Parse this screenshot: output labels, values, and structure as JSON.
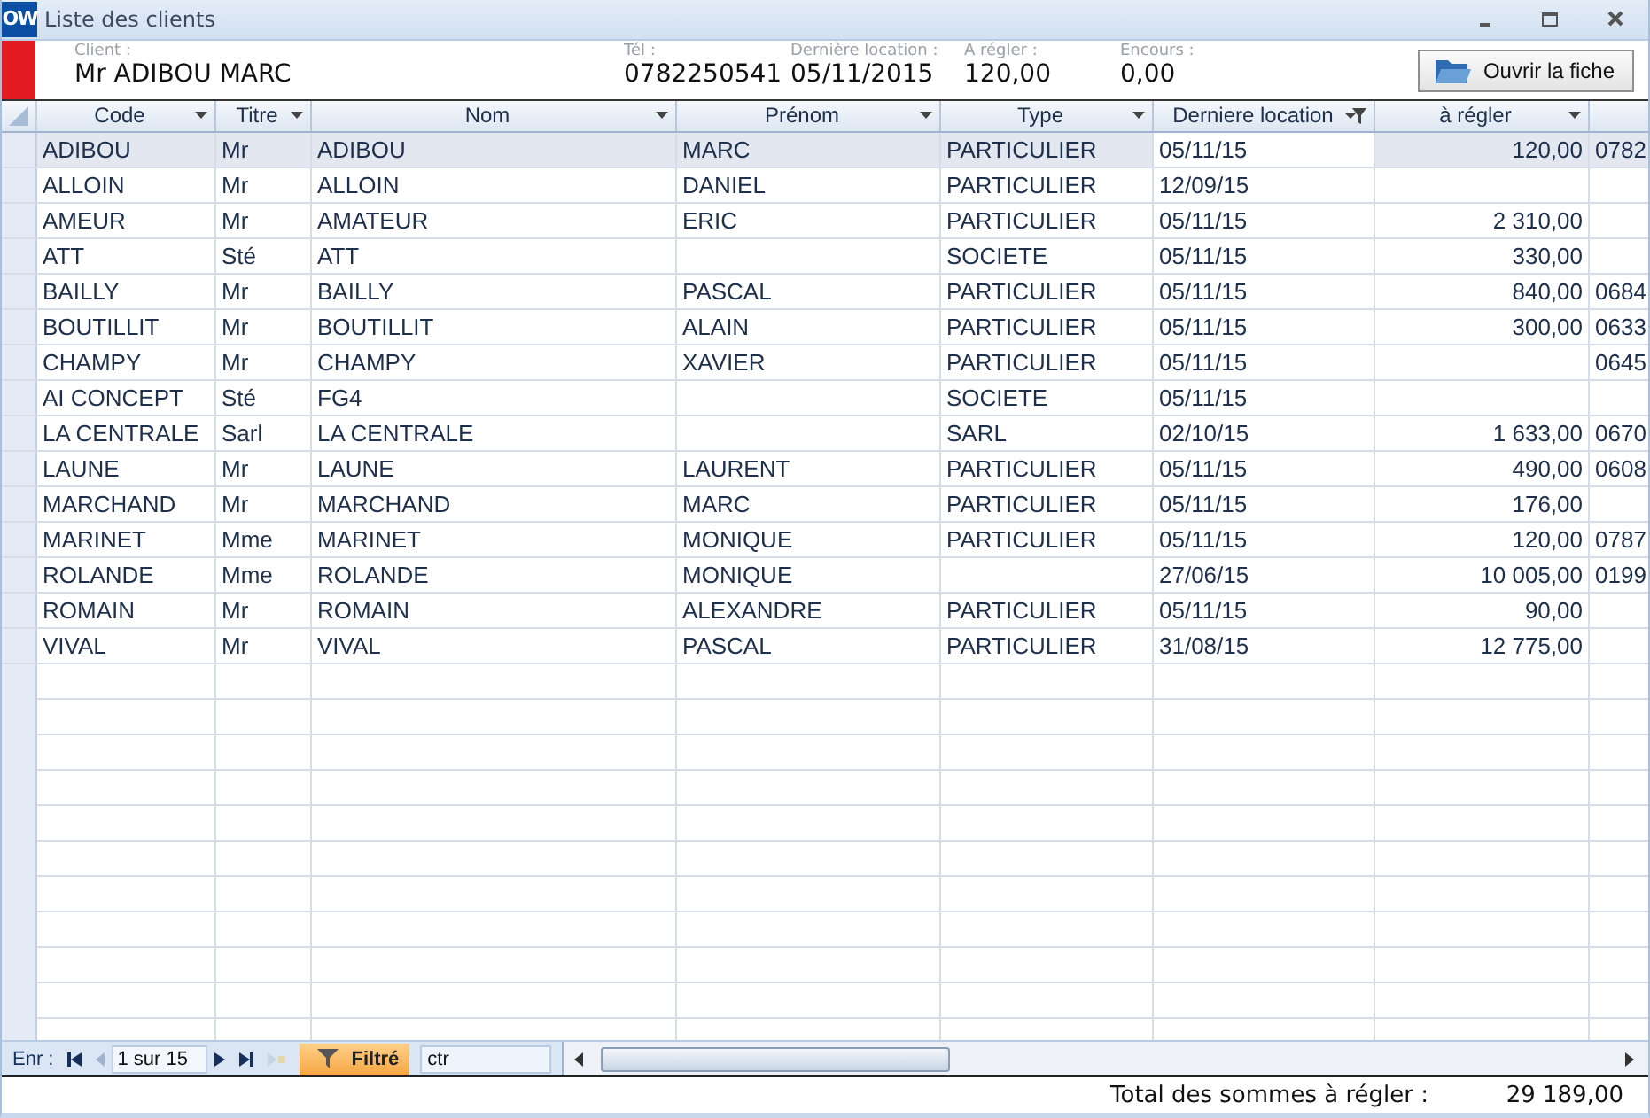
{
  "window": {
    "badge": "OW",
    "title": "Liste des clients"
  },
  "summary": {
    "fields": [
      {
        "label": "Client :",
        "value": "Mr ADIBOU MARC"
      },
      {
        "label": "Tél :",
        "value": "0782250541"
      },
      {
        "label": "Dernière location :",
        "value": "05/11/2015"
      },
      {
        "label": "A régler :",
        "value": "120,00"
      },
      {
        "label": "Encours :",
        "value": "0,00"
      }
    ],
    "open_button": "Ouvrir la fiche"
  },
  "table": {
    "columns": [
      {
        "label": "Code",
        "filtered": false
      },
      {
        "label": "Titre",
        "filtered": false
      },
      {
        "label": "Nom",
        "filtered": false
      },
      {
        "label": "Prénom",
        "filtered": false
      },
      {
        "label": "Type",
        "filtered": false
      },
      {
        "label": "Derniere location",
        "filtered": true
      },
      {
        "label": "à régler",
        "filtered": false
      },
      {}
    ],
    "rows": [
      {
        "selected": true,
        "cells": [
          "ADIBOU",
          "Mr",
          "ADIBOU",
          "MARC",
          "PARTICULIER",
          "05/11/15",
          "120,00",
          "0782"
        ]
      },
      {
        "selected": false,
        "cells": [
          "ALLOIN",
          "Mr",
          "ALLOIN",
          "DANIEL",
          "PARTICULIER",
          "12/09/15",
          null,
          null
        ]
      },
      {
        "selected": false,
        "cells": [
          "AMEUR",
          "Mr",
          "AMATEUR",
          "ERIC",
          "PARTICULIER",
          "05/11/15",
          "2 310,00",
          null
        ]
      },
      {
        "selected": false,
        "cells": [
          "ATT",
          "Sté",
          "ATT",
          null,
          "SOCIETE",
          "05/11/15",
          "330,00",
          null
        ]
      },
      {
        "selected": false,
        "cells": [
          "BAILLY",
          "Mr",
          "BAILLY",
          "PASCAL",
          "PARTICULIER",
          "05/11/15",
          "840,00",
          "0684"
        ]
      },
      {
        "selected": false,
        "cells": [
          "BOUTILLIT",
          "Mr",
          "BOUTILLIT",
          "ALAIN",
          "PARTICULIER",
          "05/11/15",
          "300,00",
          "0633"
        ]
      },
      {
        "selected": false,
        "cells": [
          "CHAMPY",
          "Mr",
          "CHAMPY",
          "XAVIER",
          "PARTICULIER",
          "05/11/15",
          null,
          "0645"
        ]
      },
      {
        "selected": false,
        "cells": [
          "AI CONCEPT",
          "Sté",
          "FG4",
          null,
          "SOCIETE",
          "05/11/15",
          null,
          null
        ]
      },
      {
        "selected": false,
        "cells": [
          "LA CENTRALE",
          "Sarl",
          "LA CENTRALE",
          null,
          "SARL",
          "02/10/15",
          "1 633,00",
          "0670"
        ]
      },
      {
        "selected": false,
        "cells": [
          "LAUNE",
          "Mr",
          "LAUNE",
          "LAURENT",
          "PARTICULIER",
          "05/11/15",
          "490,00",
          "0608"
        ]
      },
      {
        "selected": false,
        "cells": [
          "MARCHAND",
          "Mr",
          "MARCHAND",
          "MARC",
          "PARTICULIER",
          "05/11/15",
          "176,00",
          null
        ]
      },
      {
        "selected": false,
        "cells": [
          "MARINET",
          "Mme",
          "MARINET",
          "MONIQUE",
          "PARTICULIER",
          "05/11/15",
          "120,00",
          "0787"
        ]
      },
      {
        "selected": false,
        "cells": [
          "ROLANDE",
          "Mme",
          "ROLANDE",
          "MONIQUE",
          null,
          "27/06/15",
          "10 005,00",
          "0199"
        ]
      },
      {
        "selected": false,
        "cells": [
          "ROMAIN",
          "Mr",
          "ROMAIN",
          "ALEXANDRE",
          "PARTICULIER",
          "05/11/15",
          "90,00",
          null
        ]
      },
      {
        "selected": false,
        "cells": [
          "VIVAL",
          "Mr",
          "VIVAL",
          "PASCAL",
          "PARTICULIER",
          "31/08/15",
          "12 775,00",
          null
        ]
      }
    ]
  },
  "navigation": {
    "label": "Enr :",
    "record": "1 sur 15",
    "filter_button": "Filtré",
    "filter_active": true,
    "search": "ctr"
  },
  "footer": {
    "label": "Total des sommes à régler :",
    "total": "29 189,00"
  }
}
